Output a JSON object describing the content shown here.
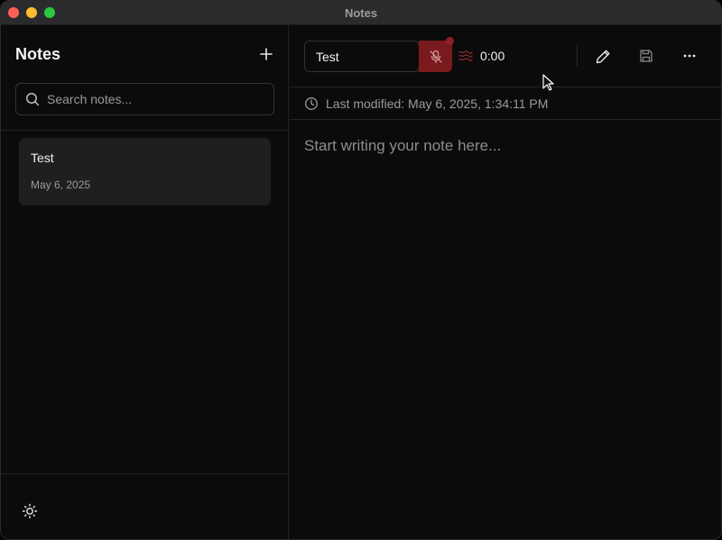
{
  "window": {
    "title": "Notes"
  },
  "sidebar": {
    "title": "Notes",
    "search_placeholder": "Search notes...",
    "notes": [
      {
        "title": "Test",
        "date": "May 6, 2025"
      }
    ]
  },
  "editor": {
    "note_title": "Test",
    "timer": "0:00",
    "modified": "Last modified: May 6, 2025, 1:34:11 PM",
    "placeholder": "Start writing your note here..."
  },
  "icons": {
    "add": "plus-icon",
    "search": "search-icon",
    "mic": "mic-off-icon",
    "wave": "waveform-icon",
    "edit": "pencil-icon",
    "save": "save-icon",
    "more": "more-horizontal-icon",
    "clock": "clock-icon",
    "theme": "sun-icon"
  },
  "colors": {
    "accent_record": "#7a1a1c",
    "background": "#0b0b0c",
    "card": "#1f1f21"
  }
}
